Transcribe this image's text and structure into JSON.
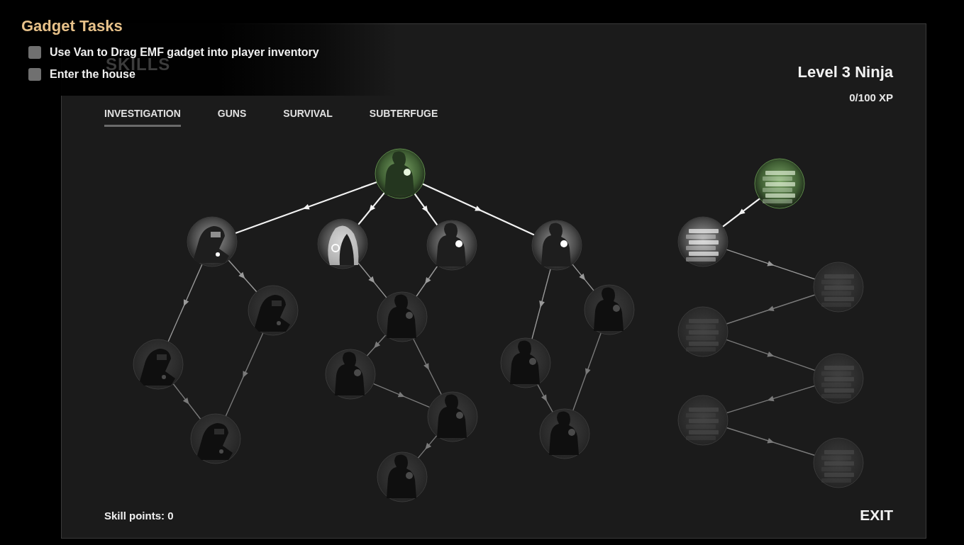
{
  "tasks": {
    "title": "Gadget Tasks",
    "items": [
      {
        "label": "Use Van to Drag EMF gadget into player inventory",
        "checked": false
      },
      {
        "label": "Enter the house",
        "checked": false
      }
    ]
  },
  "panel_title": "SKILLS",
  "level": {
    "title": "Level 3 Ninja",
    "xp": "0/100 XP"
  },
  "tabs": [
    {
      "label": "INVESTIGATION",
      "selected": true
    },
    {
      "label": "GUNS",
      "selected": false
    },
    {
      "label": "SURVIVAL",
      "selected": false
    },
    {
      "label": "SUBTERFUGE",
      "selected": false
    }
  ],
  "tree": {
    "nodes": [
      {
        "kind": "hooded-figure",
        "learned": true,
        "locked": false
      },
      {
        "kind": "welder",
        "learned": false,
        "locked": false
      },
      {
        "kind": "hood",
        "learned": false,
        "locked": false
      },
      {
        "kind": "hooded-figure",
        "learned": false,
        "locked": false
      },
      {
        "kind": "hooded-figure",
        "learned": false,
        "locked": false
      },
      {
        "kind": "welder",
        "learned": false,
        "locked": true
      },
      {
        "kind": "welder",
        "learned": false,
        "locked": true
      },
      {
        "kind": "welder",
        "learned": false,
        "locked": true
      },
      {
        "kind": "hooded-figure",
        "learned": false,
        "locked": true
      },
      {
        "kind": "hooded-figure",
        "learned": false,
        "locked": true
      },
      {
        "kind": "hooded-figure",
        "learned": false,
        "locked": true
      },
      {
        "kind": "hooded-figure",
        "learned": false,
        "locked": true
      },
      {
        "kind": "hooded-figure",
        "learned": false,
        "locked": true
      },
      {
        "kind": "hooded-figure",
        "learned": false,
        "locked": true
      },
      {
        "kind": "hooded-figure",
        "learned": false,
        "locked": true
      },
      {
        "kind": "books",
        "learned": true,
        "locked": false
      },
      {
        "kind": "books",
        "learned": false,
        "locked": false
      },
      {
        "kind": "books",
        "learned": false,
        "locked": true
      },
      {
        "kind": "books",
        "learned": false,
        "locked": true
      },
      {
        "kind": "books",
        "learned": false,
        "locked": true
      },
      {
        "kind": "books",
        "learned": false,
        "locked": true
      },
      {
        "kind": "books",
        "learned": false,
        "locked": true
      }
    ]
  },
  "skill_points": "Skill points: 0",
  "exit": "EXIT"
}
